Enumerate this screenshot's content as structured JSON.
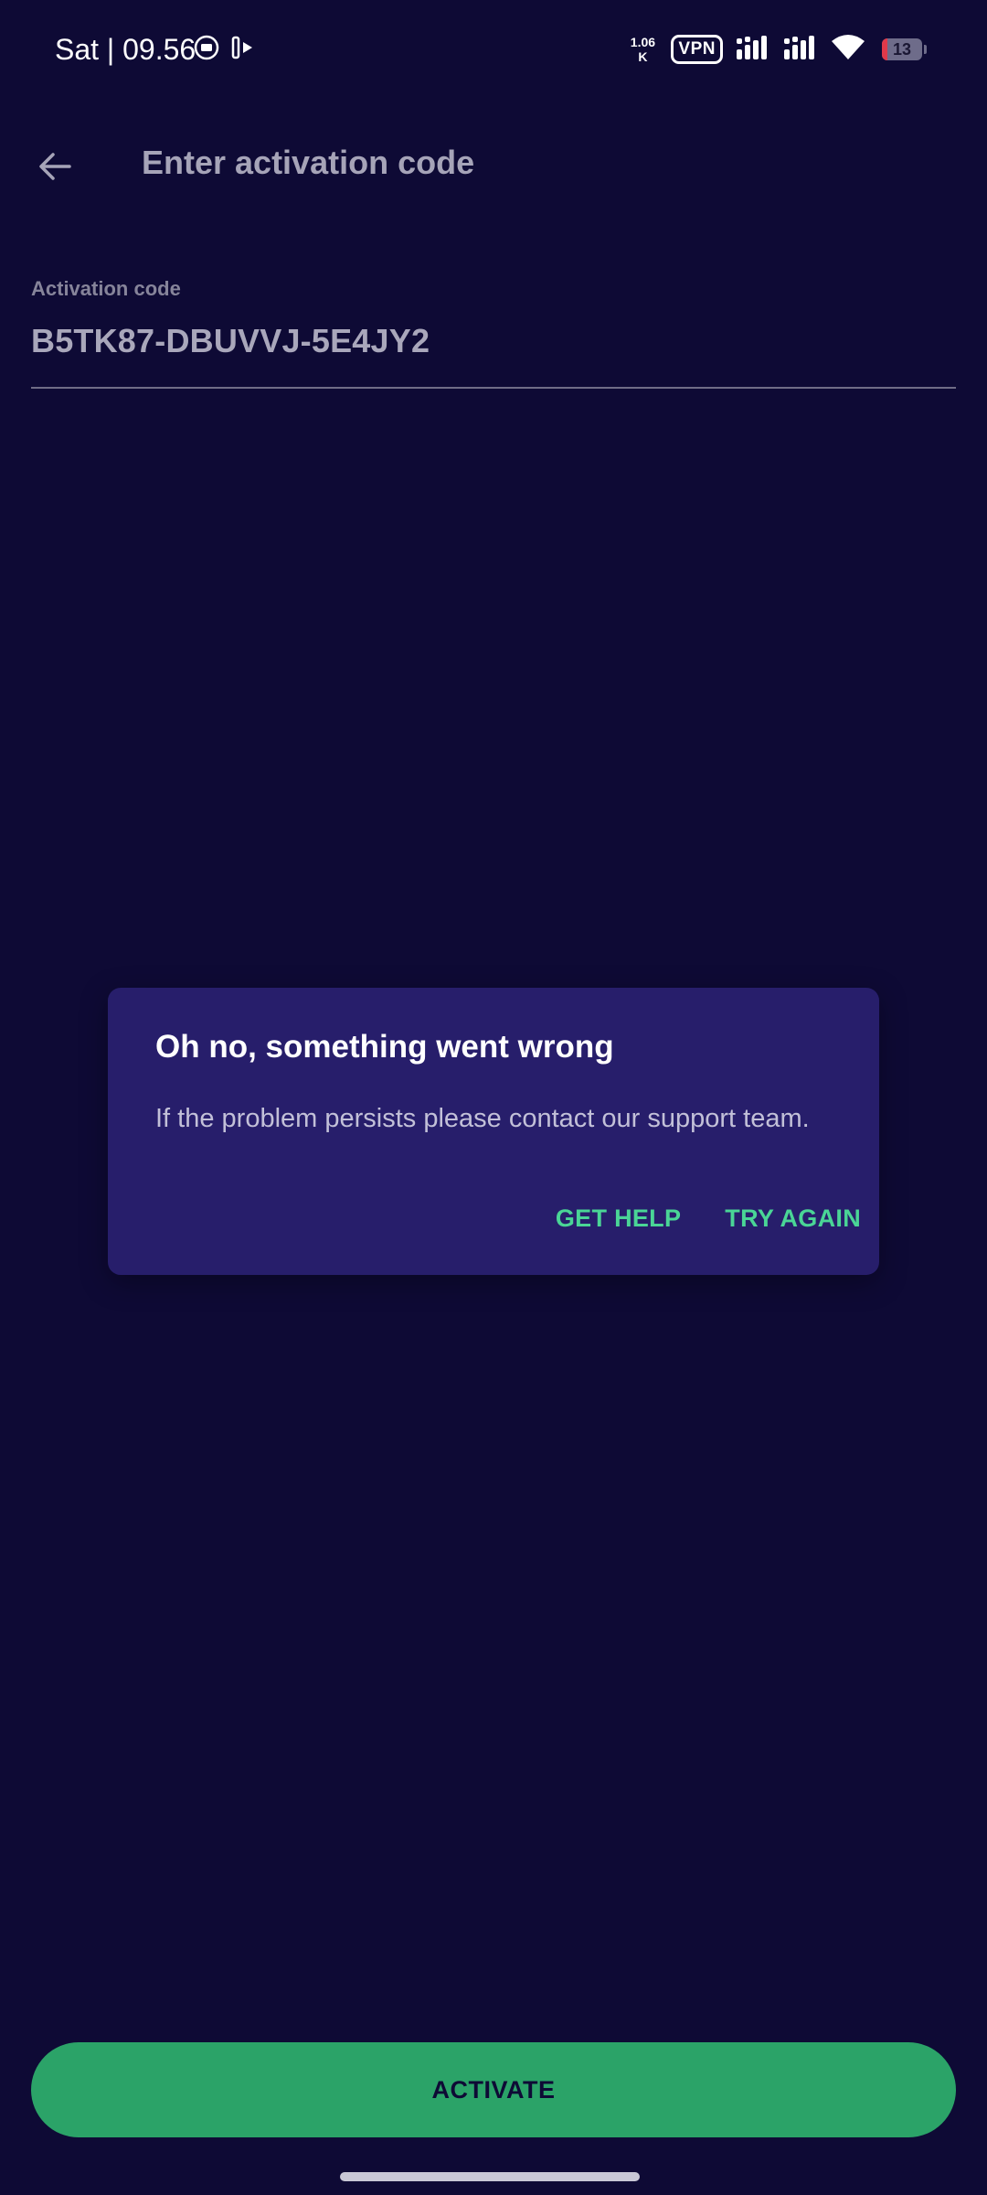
{
  "status_bar": {
    "time": "Sat | 09.56",
    "net_speed_value": "1.06",
    "net_speed_unit": "K",
    "vpn": "VPN",
    "battery_level": "13",
    "icons": [
      "screen-record-icon",
      "cast-icon",
      "signal-icon",
      "signal-icon",
      "wifi-icon",
      "battery-icon"
    ]
  },
  "app_bar": {
    "back_icon": "arrow-left-icon",
    "title": "Enter activation code"
  },
  "form": {
    "label": "Activation code",
    "value": "B5TK87-DBUVVJ-5E4JY2"
  },
  "dialog": {
    "title": "Oh no, something went wrong",
    "message": "If the problem persists please contact our support team.",
    "actions": {
      "get_help": "GET HELP",
      "try_again": "TRY AGAIN"
    }
  },
  "footer": {
    "activate_label": "ACTIVATE"
  },
  "colors": {
    "background": "#0e0a35",
    "dialog": "#271e6b",
    "accent_green": "#2ba368",
    "action_green": "#4ad596",
    "battery_low": "#e0394a"
  }
}
